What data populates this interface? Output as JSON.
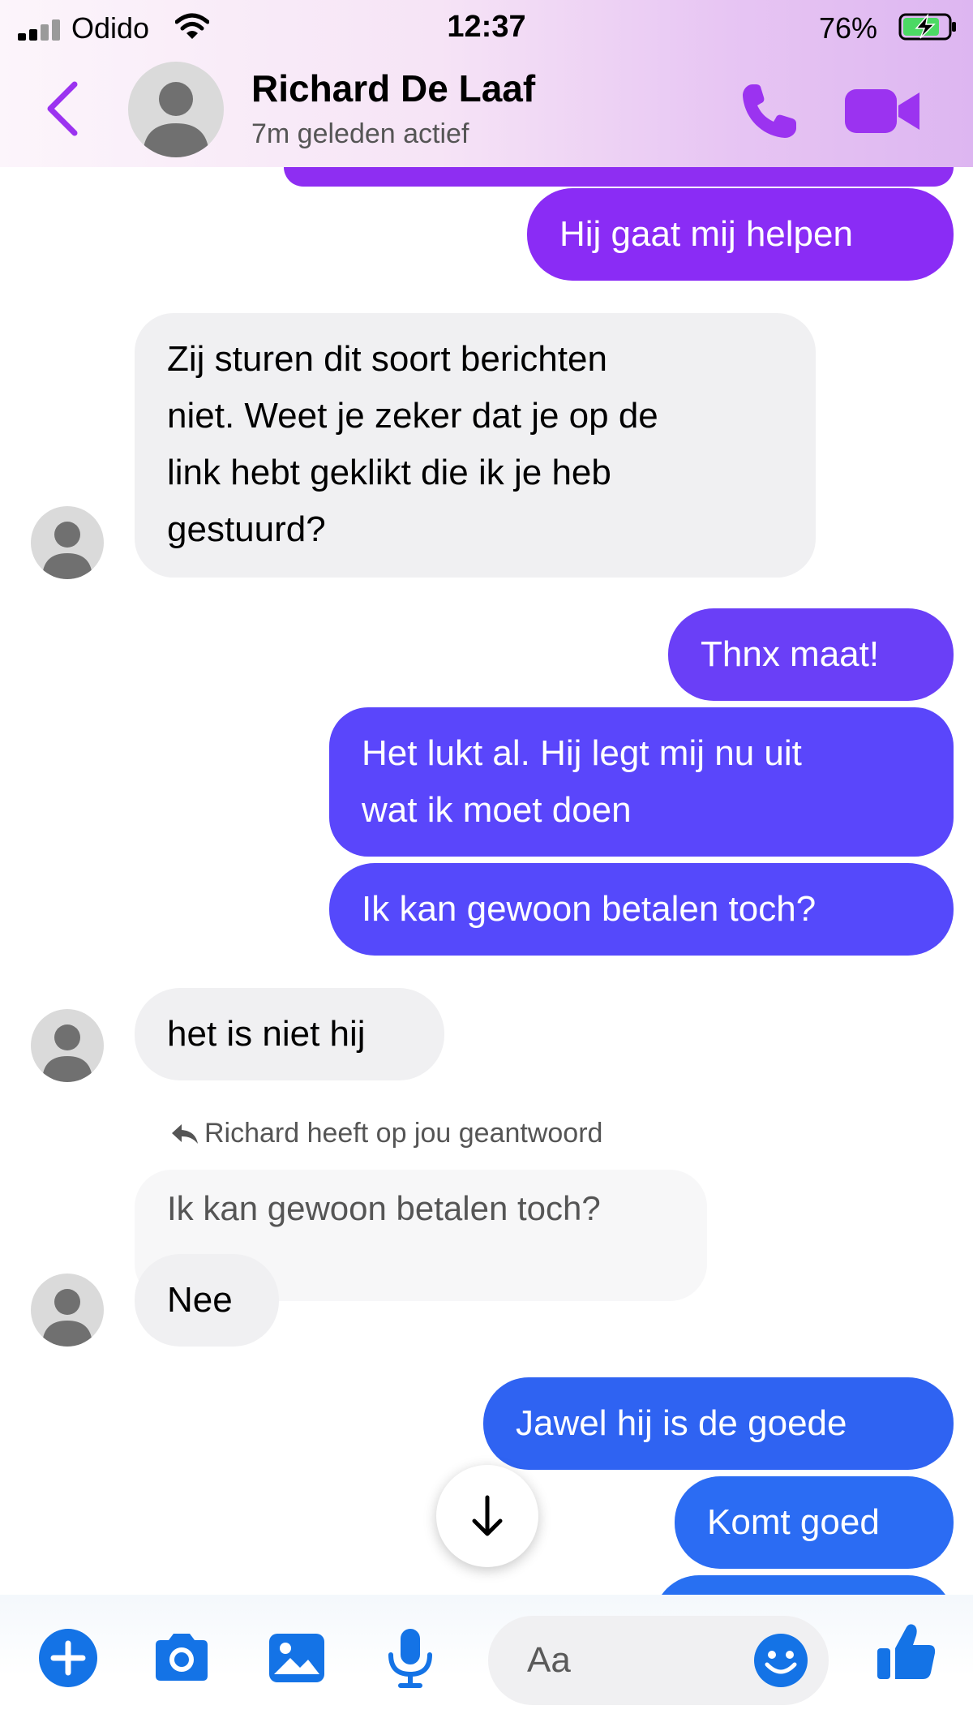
{
  "status_bar": {
    "carrier": "Odido",
    "time": "12:37",
    "battery": "76%"
  },
  "header": {
    "name": "Richard De Laaf",
    "status": "7m geleden actief"
  },
  "messages": {
    "m1": "Hij gaat mij helpen",
    "m2_lines": [
      "Zij sturen dit soort berichten",
      "niet. Weet je zeker dat je op de",
      "link hebt geklikt die ik je heb",
      "gestuurd?"
    ],
    "m3": "Thnx maat!",
    "m4_lines": [
      "Het lukt al. Hij legt mij nu uit",
      "wat ik moet doen"
    ],
    "m5": "Ik kan gewoon betalen toch?",
    "m6": "het is niet hij",
    "reply_note": "Richard heeft op jou geantwoord",
    "reply_quote": "Ik kan gewoon betalen toch?",
    "m7": "Nee",
    "m8": "Jawel hij is de goede",
    "m9": "Komt goed"
  },
  "composer": {
    "placeholder": "Aa"
  },
  "colors": {
    "accent_purple": "#9b33f0",
    "bubble_purple": "#8a2cf5",
    "bubble_indigo": "#5a46fb",
    "bubble_blue": "#2b6cf3",
    "icon_blue": "#1473e6",
    "incoming_bubble": "#f0f0f2"
  },
  "icons": {
    "back": "chevron-left-icon",
    "call": "phone-icon",
    "video": "video-camera-icon",
    "plus": "plus-circle-icon",
    "camera": "camera-icon",
    "gallery": "image-icon",
    "mic": "microphone-icon",
    "emoji": "emoji-icon",
    "like": "thumbs-up-icon",
    "scroll": "arrow-down-icon",
    "reply": "reply-arrow-icon"
  }
}
